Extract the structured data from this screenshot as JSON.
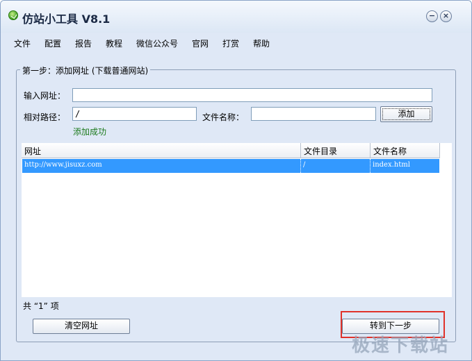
{
  "window": {
    "title": "仿站小工具 V8.1",
    "minimize_glyph": "−",
    "close_glyph": "×"
  },
  "menu": [
    "文件",
    "配置",
    "报告",
    "教程",
    "微信公众号",
    "官网",
    "打赏",
    "帮助"
  ],
  "step": {
    "legend": "第一步：添加网址 (下载普通网站)",
    "url_label": "输入网址：",
    "url_value": "",
    "path_label": "相对路径：",
    "path_value": "/",
    "filename_label": "文件名称：",
    "filename_value": "",
    "add_button": "添加",
    "status": "添加成功"
  },
  "table": {
    "columns": [
      "网址",
      "文件目录",
      "文件名称"
    ],
    "rows": [
      {
        "url": "http://www.jisuxz.com",
        "dir": "/",
        "file": "index.html",
        "selected": true
      }
    ]
  },
  "count_text": "共 “1” 项",
  "clear_button": "清空网址",
  "next_button": "转到下一步",
  "watermark": "极速下载站",
  "colors": {
    "selection": "#3399ff",
    "window_bg": "#dfe8f6",
    "highlight_border": "#e0322a",
    "success_text": "#1c7a1c"
  }
}
